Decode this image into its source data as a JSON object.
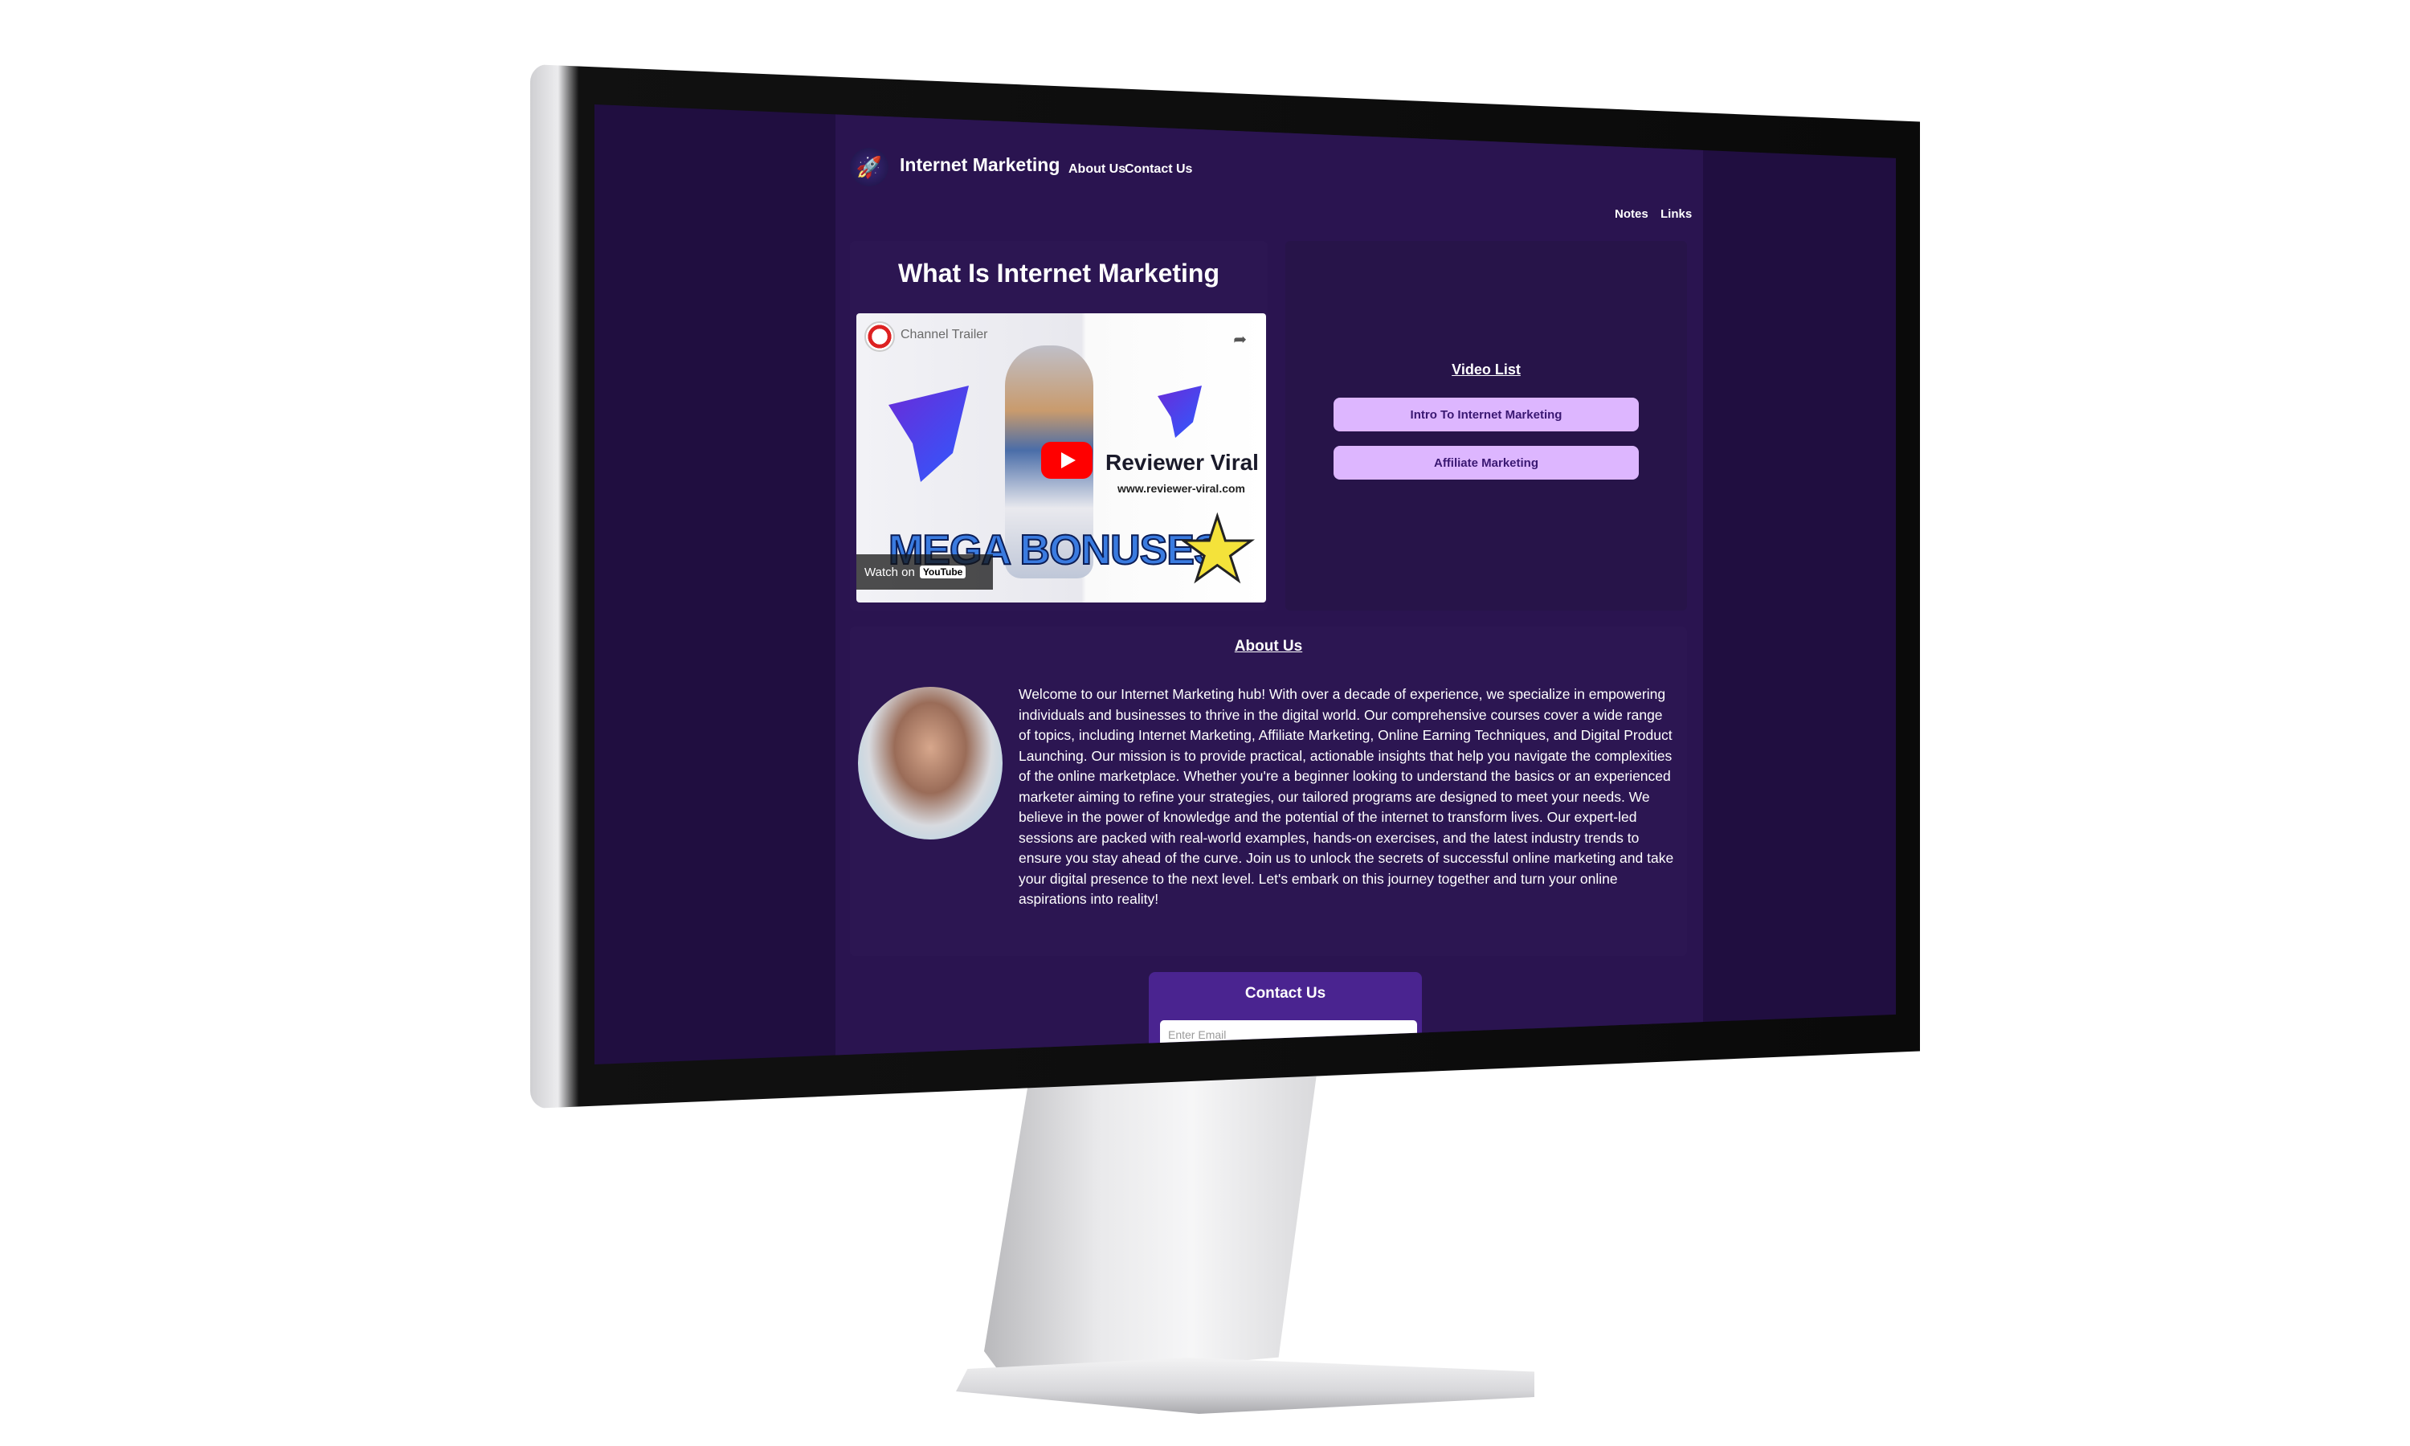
{
  "nav": {
    "brand": "Internet Marketing",
    "links": [
      "About Us",
      "Contact Us"
    ],
    "right_links": [
      "Notes",
      "Links"
    ]
  },
  "video": {
    "title": "What Is Internet Marketing",
    "embed": {
      "channel_label": "Channel Trailer",
      "brand_text": "Reviewer Viral",
      "brand_url": "www.reviewer-viral.com",
      "banner": "MEGA BONUSES",
      "watch_on": "Watch on",
      "youtube": "YouTube"
    }
  },
  "playlist": {
    "title": "Video List",
    "items": [
      "Intro To Internet Marketing",
      "Affiliate Marketing"
    ]
  },
  "about": {
    "title": "About Us",
    "text": "Welcome to our Internet Marketing hub! With over a decade of experience, we specialize in empowering individuals and businesses to thrive in the digital world. Our comprehensive courses cover a wide range of topics, including Internet Marketing, Affiliate Marketing, Online Earning Techniques, and Digital Product Launching. Our mission is to provide practical, actionable insights that help you navigate the complexities of the online marketplace. Whether you're a beginner looking to understand the basics or an experienced marketer aiming to refine your strategies, our tailored programs are designed to meet your needs. We believe in the power of knowledge and the potential of the internet to transform lives. Our expert-led sessions are packed with real-world examples, hands-on exercises, and the latest industry trends to ensure you stay ahead of the curve. Join us to unlock the secrets of successful online marketing and take your digital presence to the next level. Let's embark on this journey together and turn your online aspirations into reality!"
  },
  "contact": {
    "title": "Contact Us",
    "email_placeholder": "Enter Email"
  },
  "colors": {
    "page_bg": "#200e40",
    "card_bg": "#2c1652",
    "button_bg": "#ddb6ff",
    "contact_bg": "#4a2490"
  }
}
